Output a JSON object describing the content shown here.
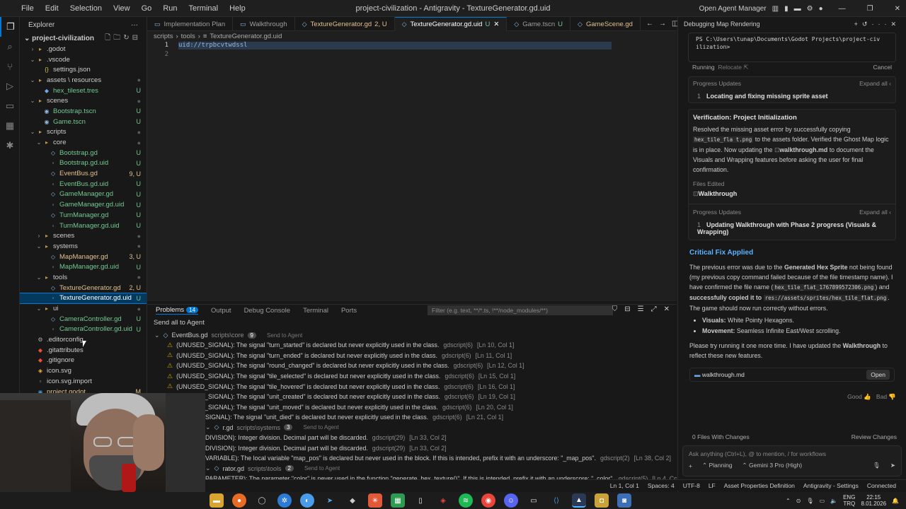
{
  "window": {
    "title": "project-civilization - Antigravity - TextureGenerator.gd.uid",
    "menu": [
      "File",
      "Edit",
      "Selection",
      "View",
      "Go",
      "Run",
      "Terminal",
      "Help"
    ],
    "open_agent_manager": "Open Agent Manager"
  },
  "sidebar": {
    "header": "Explorer",
    "root": "project-civilization",
    "items": [
      {
        "label": ".godot",
        "indent": 1,
        "kind": "folder",
        "chev": "›",
        "status": ""
      },
      {
        "label": ".vscode",
        "indent": 1,
        "kind": "folder",
        "chev": "⌄",
        "status": ""
      },
      {
        "label": "settings.json",
        "indent": 2,
        "kind": "json",
        "chev": "",
        "status": ""
      },
      {
        "label": "assets \\ resources",
        "indent": 1,
        "kind": "folder",
        "chev": "⌄",
        "status": "dot"
      },
      {
        "label": "hex_tileset.tres",
        "indent": 2,
        "kind": "res",
        "chev": "",
        "status": "U"
      },
      {
        "label": "scenes",
        "indent": 1,
        "kind": "folder",
        "chev": "⌄",
        "status": "dot"
      },
      {
        "label": "Bootstrap.tscn",
        "indent": 2,
        "kind": "scene",
        "chev": "",
        "status": "U"
      },
      {
        "label": "Game.tscn",
        "indent": 2,
        "kind": "scene",
        "chev": "",
        "status": "U"
      },
      {
        "label": "scripts",
        "indent": 1,
        "kind": "folder",
        "chev": "⌄",
        "status": "dot"
      },
      {
        "label": "core",
        "indent": 2,
        "kind": "folder",
        "chev": "⌄",
        "status": "dot"
      },
      {
        "label": "Bootstrap.gd",
        "indent": 3,
        "kind": "gd",
        "chev": "",
        "status": "U"
      },
      {
        "label": "Bootstrap.gd.uid",
        "indent": 3,
        "kind": "uid",
        "chev": "",
        "status": "U"
      },
      {
        "label": "EventBus.gd",
        "indent": 3,
        "kind": "gd",
        "chev": "",
        "status": "9, U"
      },
      {
        "label": "EventBus.gd.uid",
        "indent": 3,
        "kind": "uid",
        "chev": "",
        "status": "U"
      },
      {
        "label": "GameManager.gd",
        "indent": 3,
        "kind": "gd",
        "chev": "",
        "status": "U"
      },
      {
        "label": "GameManager.gd.uid",
        "indent": 3,
        "kind": "uid",
        "chev": "",
        "status": "U"
      },
      {
        "label": "TurnManager.gd",
        "indent": 3,
        "kind": "gd",
        "chev": "",
        "status": "U"
      },
      {
        "label": "TurnManager.gd.uid",
        "indent": 3,
        "kind": "uid",
        "chev": "",
        "status": "U"
      },
      {
        "label": "scenes",
        "indent": 2,
        "kind": "folder",
        "chev": "›",
        "status": "dot"
      },
      {
        "label": "systems",
        "indent": 2,
        "kind": "folder",
        "chev": "⌄",
        "status": "dot"
      },
      {
        "label": "MapManager.gd",
        "indent": 3,
        "kind": "gd",
        "chev": "",
        "status": "3, U"
      },
      {
        "label": "MapManager.gd.uid",
        "indent": 3,
        "kind": "uid",
        "chev": "",
        "status": "U"
      },
      {
        "label": "tools",
        "indent": 2,
        "kind": "folder",
        "chev": "⌄",
        "status": "dot"
      },
      {
        "label": "TextureGenerator.gd",
        "indent": 3,
        "kind": "gd",
        "chev": "",
        "status": "2, U"
      },
      {
        "label": "TextureGenerator.gd.uid",
        "indent": 3,
        "kind": "uid",
        "chev": "",
        "status": "U",
        "selected": true
      },
      {
        "label": "ui",
        "indent": 2,
        "kind": "folder",
        "chev": "⌄",
        "status": "dot"
      },
      {
        "label": "CameraController.gd",
        "indent": 3,
        "kind": "gd",
        "chev": "",
        "status": "U"
      },
      {
        "label": "CameraController.gd.uid",
        "indent": 3,
        "kind": "uid",
        "chev": "",
        "status": "U"
      },
      {
        "label": ".editorconfig",
        "indent": 1,
        "kind": "gear",
        "chev": "",
        "status": ""
      },
      {
        "label": ".gitattributes",
        "indent": 1,
        "kind": "git",
        "chev": "",
        "status": ""
      },
      {
        "label": ".gitignore",
        "indent": 1,
        "kind": "git",
        "chev": "",
        "status": ""
      },
      {
        "label": "icon.svg",
        "indent": 1,
        "kind": "svg",
        "chev": "",
        "status": ""
      },
      {
        "label": "icon.svg.import",
        "indent": 1,
        "kind": "file",
        "chev": "",
        "status": ""
      },
      {
        "label": "project.godot",
        "indent": 1,
        "kind": "godot",
        "chev": "",
        "status": "M"
      }
    ]
  },
  "tabs": [
    {
      "label": "Implementation Plan",
      "status": "",
      "active": false,
      "mod": false
    },
    {
      "label": "Walkthrough",
      "status": "",
      "active": false,
      "mod": false
    },
    {
      "label": "TextureGenerator.gd",
      "status": "2, U",
      "active": false,
      "mod": true
    },
    {
      "label": "TextureGenerator.gd.uid",
      "status": "U",
      "active": true,
      "mod": false
    },
    {
      "label": "Game.tscn",
      "status": "U",
      "active": false,
      "mod": false
    },
    {
      "label": "GameScene.gd",
      "status": "",
      "active": false,
      "mod": true
    }
  ],
  "breadcrumb": [
    "scripts",
    "tools",
    "TextureGenerator.gd.uid"
  ],
  "editor": {
    "lines": [
      "uid://trpbcvtwdssl",
      ""
    ]
  },
  "panel": {
    "tabs": [
      "Problems",
      "Output",
      "Debug Console",
      "Terminal",
      "Ports"
    ],
    "problems_count": "14",
    "filter_placeholder": "Filter (e.g. text, **/*.ts, !**/node_modules/**)",
    "send_all": "Send all to Agent",
    "groups": [
      {
        "file": "EventBus.gd",
        "path": "scripts\\core",
        "count": "9",
        "send": "Send to Agent",
        "rows": [
          {
            "text": "(UNUSED_SIGNAL): The signal \"turn_started\" is declared but never explicitly used in the class.",
            "src": "gdscript(6)",
            "pos": "[Ln 10, Col 1]"
          },
          {
            "text": "(UNUSED_SIGNAL): The signal \"turn_ended\" is declared but never explicitly used in the class.",
            "src": "gdscript(6)",
            "pos": "[Ln 11, Col 1]"
          },
          {
            "text": "(UNUSED_SIGNAL): The signal \"round_changed\" is declared but never explicitly used in the class.",
            "src": "gdscript(6)",
            "pos": "[Ln 12, Col 1]"
          },
          {
            "text": "(UNUSED_SIGNAL): The signal \"tile_selected\" is declared but never explicitly used in the class.",
            "src": "gdscript(6)",
            "pos": "[Ln 15, Col 1]"
          },
          {
            "text": "(UNUSED_SIGNAL): The signal \"tile_hovered\" is declared but never explicitly used in the class.",
            "src": "gdscript(6)",
            "pos": "[Ln 16, Col 1]"
          },
          {
            "text": "(UNUSED_SIGNAL): The signal \"unit_created\" is declared but never explicitly used in the class.",
            "src": "gdscript(6)",
            "pos": "[Ln 19, Col 1]"
          },
          {
            "text": "(UNUSED_SIGNAL): The signal \"unit_moved\" is declared but never explicitly used in the class.",
            "src": "gdscript(6)",
            "pos": "[Ln 20, Col 1]"
          },
          {
            "text": "SIGNAL): The signal \"unit_died\" is declared but never explicitly used in the class.",
            "src": "gdscript(6)",
            "pos": "[Ln 21, Col 1]"
          }
        ]
      },
      {
        "file": "r.gd",
        "path": "scripts\\systems",
        "count": "3",
        "send": "Send to Agent",
        "rows": [
          {
            "text": "DIVISION): Integer division. Decimal part will be discarded.",
            "src": "gdscript(29)",
            "pos": "[Ln 33, Col 2]"
          },
          {
            "text": "DIVISION): Integer division. Decimal part will be discarded.",
            "src": "gdscript(29)",
            "pos": "[Ln 33, Col 2]"
          },
          {
            "text": "VARIABLE): The local variable \"map_pos\" is declared but never used in the block. If this is intended, prefix it with an underscore: \"_map_pos\".",
            "src": "gdscript(2)",
            "pos": "[Ln 38, Col 2]"
          }
        ]
      },
      {
        "file": "rator.gd",
        "path": "scripts\\tools",
        "count": "2",
        "send": "Send to Agent",
        "rows": [
          {
            "text": "PARAMETER): The parameter \"color\" is never used in the function \"generate_hex_texture()\". If this is intended, prefix it with an underscore: \"_color\".",
            "src": "gdscript(5)",
            "pos": "[Ln 4, Col 1]"
          }
        ]
      }
    ]
  },
  "agent": {
    "header": "Debugging Map Rendering",
    "terminal_lines": [
      "PS C:\\Users\\tunap\\Documents\\Godot Projects\\project-civ",
      "ilization>"
    ],
    "running": "Running",
    "relocate": "Relocate",
    "cancel": "Cancel",
    "progress_label": "Progress Updates",
    "expand_all": "Expand all",
    "progress1": {
      "num": "1",
      "text": "Locating and fixing missing sprite asset"
    },
    "verification_title": "Verification: Project Initialization",
    "verification_p1": "Resolved the missing asset error by successfully copying",
    "verification_code1": "hex_tile_fla t.png",
    "verification_p2": "to the assets folder. Verified the Ghost Map logic is in place. Now updating the",
    "verification_bold": "walkthrough.md",
    "verification_p3": "to document the Visuals and Wrapping features before asking the user for final confirmation.",
    "files_edited_label": "Files Edited",
    "files_edited": "Walkthrough",
    "progress2": {
      "num": "1",
      "text": "Updating Walkthrough with Phase 2 progress (Visuals & Wrapping)"
    },
    "critical_title": "Critical Fix Applied",
    "crit_p1a": "The previous error was due to the",
    "crit_p1b": "Generated Hex Sprite",
    "crit_p1c": "not being found (my previous copy command failed because of the file timestamp name). I have confirmed the file name (",
    "crit_code1": "hex_tile_flat_1767899572306.png",
    "crit_p1d": ") and",
    "crit_p1e": "successfully copied it to",
    "crit_code2": "res://assets/sprites/hex_tile_flat.png",
    "crit_p1f": ".",
    "crit_p2": "The game should now run correctly without errors.",
    "bullets": [
      {
        "k": "Visuals:",
        "v": "White Pointy Hexagons."
      },
      {
        "k": "Movement:",
        "v": "Seamless Infinite East/West scrolling."
      }
    ],
    "crit_p3a": "Please try running it one more time. I have updated the",
    "crit_p3b": "Walkthrough",
    "crit_p3c": "to reflect these new features.",
    "file_chip": "walkthrough.md",
    "open": "Open",
    "good": "Good",
    "bad": "Bad",
    "files_with_changes": "0 Files With Changes",
    "review_changes": "Review Changes",
    "input_placeholder": "Ask anything (Ctrl+L), @ to mention, / for workflows",
    "mode": "Planning",
    "model": "Gemini 3 Pro (High)"
  },
  "statusbar": [
    "Ln 1, Col 1",
    "Spaces: 4",
    "UTF-8",
    "LF",
    "Asset Properties Definition",
    "Antigravity - Settings",
    "Connected"
  ],
  "taskbar": {
    "lang": "ENG",
    "region": "TRQ",
    "time": "22:15",
    "date": "8.01.2026"
  }
}
